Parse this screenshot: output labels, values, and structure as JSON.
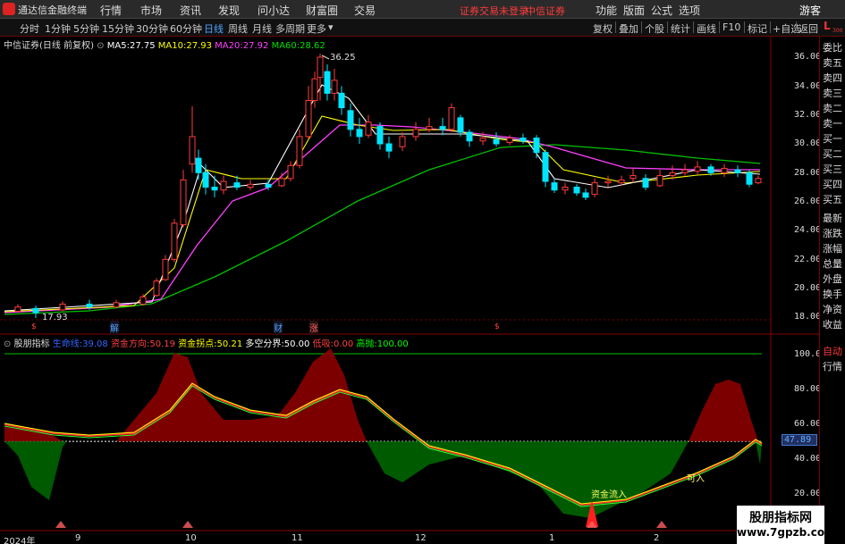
{
  "menubar": {
    "app_title": "通达信金融终端",
    "items": [
      "行情",
      "市场",
      "资讯",
      "发现",
      "问小达",
      "财富圈",
      "交易"
    ],
    "login_notice": "证券交易未登录",
    "broker": "中信证券",
    "right_items": [
      "功能",
      "版面",
      "公式",
      "选项"
    ],
    "guest": "游客"
  },
  "toolbar": {
    "periods": [
      "分时",
      "1分钟",
      "5分钟",
      "15分钟",
      "30分钟",
      "60分钟",
      "日线",
      "周线",
      "月线",
      "多周期",
      "更多"
    ],
    "active_period": "日线",
    "right_items": [
      "复权",
      "叠加",
      "个股",
      "统计",
      "画线",
      "F10",
      "标记",
      "+自选",
      "返回"
    ]
  },
  "main_chart": {
    "stock_name": "中信证券",
    "mode": "(日线 前复权)",
    "ma5_label": "MA5:",
    "ma5": "27.75",
    "ma10_label": "MA10:",
    "ma10": "27.93",
    "ma20_label": "MA20:",
    "ma20": "27.92",
    "ma60_label": "MA60:",
    "ma60": "28.62",
    "high_label": "36.25",
    "low_label": "17.93",
    "price_ticks": [
      "36.00",
      "34.00",
      "32.00",
      "30.00",
      "28.00",
      "26.00",
      "24.00",
      "22.00",
      "20.00",
      "18.00"
    ],
    "event_markers": [
      "解",
      "财",
      "涨"
    ],
    "colors": {
      "up": "#ff3b3b",
      "down": "#00e5ff",
      "ma5": "#ffffff",
      "ma10": "#ffff00",
      "ma20": "#ff40ff",
      "ma60": "#00c000"
    }
  },
  "indicator": {
    "name": "股朋指标",
    "fields": [
      {
        "label": "生命线:",
        "value": "39.08",
        "color": "#3366ff"
      },
      {
        "label": "资金方向:",
        "value": "50.19",
        "color": "#ff4040"
      },
      {
        "label": "资金拐点:",
        "value": "50.21",
        "color": "#ffff00"
      },
      {
        "label": "多空分界:",
        "value": "50.00",
        "color": "#ffffff"
      },
      {
        "label": "低吸:",
        "value": "0.00",
        "color": "#ff4040"
      },
      {
        "label": "高抛:",
        "value": "100.00",
        "color": "#00ff00"
      }
    ],
    "ticks": [
      "100.0",
      "80.00",
      "60.00",
      "40.00",
      "20.00"
    ],
    "current_value": "47.89",
    "annotations": [
      "资金流入",
      "可入"
    ]
  },
  "date_axis": [
    "2024年",
    "9",
    "10",
    "11",
    "12",
    "1",
    "2"
  ],
  "quote_panel": {
    "items": [
      "委比",
      "卖五",
      "卖四",
      "卖三",
      "卖二",
      "卖一",
      "买一",
      "买二",
      "买三",
      "买四",
      "买五",
      "最新",
      "涨跌",
      "涨幅",
      "总量",
      "外盘",
      "换手",
      "净资",
      "收益",
      "自动",
      "行情"
    ],
    "badge": "L",
    "badge_sub": "300"
  },
  "watermark": {
    "line1": "股朋指标网",
    "line2": "www.7gpzb.com"
  }
}
